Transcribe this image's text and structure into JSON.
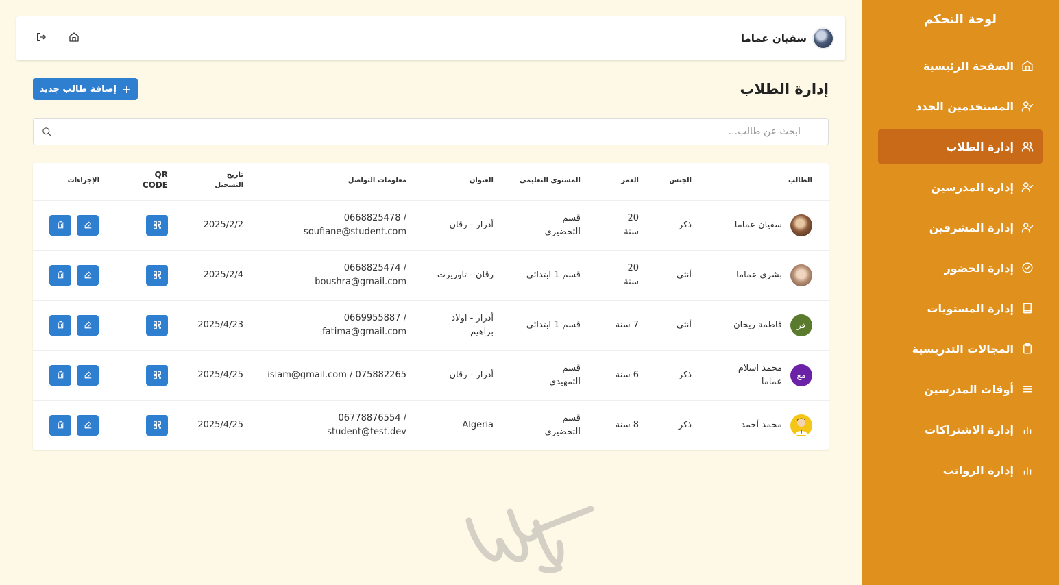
{
  "sidebar": {
    "title": "لوحة التحكم",
    "items": [
      {
        "label": "الصفحة الرئيسية",
        "icon": "home-icon"
      },
      {
        "label": "المستخدمين الجدد",
        "icon": "user-check-icon"
      },
      {
        "label": "إدارة الطلاب",
        "icon": "users-icon",
        "active": true
      },
      {
        "label": "إدارة المدرسين",
        "icon": "user-check-icon"
      },
      {
        "label": "إدارة المشرفين",
        "icon": "user-check-icon"
      },
      {
        "label": "إدارة الحضور",
        "icon": "check-circle-icon"
      },
      {
        "label": "إدارة المستويات",
        "icon": "book-icon"
      },
      {
        "label": "المجالات التدريسية",
        "icon": "clipboard-icon"
      },
      {
        "label": "أوقات المدرسين",
        "icon": "menu-icon"
      },
      {
        "label": "إدارة الاشتراكات",
        "icon": "bar-chart-icon"
      },
      {
        "label": "إدارة الرواتب",
        "icon": "bar-chart-icon"
      }
    ]
  },
  "header": {
    "user_name": "سفيان عماما"
  },
  "page": {
    "title": "إدارة الطلاب",
    "add_button": "إضافة طالب جديد",
    "search_placeholder": "ابحث عن طالب..."
  },
  "table": {
    "headers": {
      "student": "الطالب",
      "gender": "الجنس",
      "age": "العمر",
      "level": "المستوى التعليمي",
      "address": "العنوان",
      "contact": "معلومات التواصل",
      "reg_date_1": "تاريخ",
      "reg_date_2": "التسجيل",
      "qr_1": "QR",
      "qr_2": "CODE",
      "actions": "الإجراءات"
    },
    "rows": [
      {
        "name": "سفيان عماما",
        "gender": "ذكر",
        "age_1": "20",
        "age_2": "سنة",
        "level_1": "قسم",
        "level_2": "التحضيري",
        "address_1": "أدرار - رقان",
        "address_2": "",
        "contact_1": "0668825478 /",
        "contact_2": "soufiane@student.com",
        "date": "2025/2/2",
        "avatar": "photo"
      },
      {
        "name": "بشرى عماما",
        "gender": "أنثى",
        "age_1": "20",
        "age_2": "سنة",
        "level_1": "قسم 1 ابتدائي",
        "level_2": "",
        "address_1": "رقان - تاوريرت",
        "address_2": "",
        "contact_1": "0668825474 /",
        "contact_2": "boushra@gmail.com",
        "date": "2025/2/4",
        "avatar": "photo"
      },
      {
        "name": "فاطمة ريحان",
        "gender": "أنثى",
        "age_1": "7 سنة",
        "age_2": "",
        "level_1": "قسم 1 ابتدائي",
        "level_2": "",
        "address_1": "أدرار - اولاد",
        "address_2": "براهيم",
        "contact_1": "0669955887 /",
        "contact_2": "fatima@gmail.com",
        "date": "2025/4/23",
        "avatar_text": "فر",
        "avatar_color": "#5a7b2e"
      },
      {
        "name_1": "محمد اسلام",
        "name_2": "عماما",
        "gender": "ذكر",
        "age_1": "6 سنة",
        "age_2": "",
        "level_1": "قسم",
        "level_2": "التمهيدي",
        "address_1": "أدرار - رقان",
        "address_2": "",
        "contact_1": "islam@gmail.com / 075882265",
        "contact_2": "",
        "date": "2025/4/25",
        "avatar_text": "مع",
        "avatar_color": "#6c22a6"
      },
      {
        "name": "محمد أحمد",
        "gender": "ذكر",
        "age_1": "8 سنة",
        "age_2": "",
        "level_1": "قسم",
        "level_2": "التحضيري",
        "address_1": "Algeria",
        "address_2": "",
        "contact_1": "06778876554 /",
        "contact_2": "student@test.dev",
        "date": "2025/4/25",
        "avatar": "cartoon"
      }
    ]
  },
  "colors": {
    "sidebar": "#e0901c",
    "sidebar_active": "#c96a18",
    "primary": "#2f7fd1",
    "background": "#fdf9e6"
  }
}
